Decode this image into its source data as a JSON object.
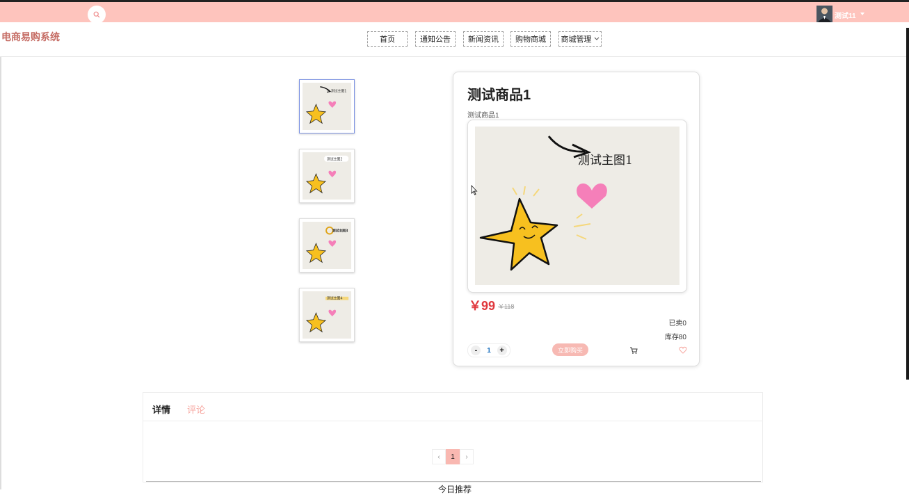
{
  "header": {
    "user_name": "测试11",
    "search_icon": "search-icon",
    "caret_icon": "caret-down-icon"
  },
  "logo": "电商易购系统",
  "nav": {
    "items": [
      {
        "label": "首页"
      },
      {
        "label": "通知公告"
      },
      {
        "label": "新闻资讯"
      },
      {
        "label": "购物商城"
      },
      {
        "label": "商城管理"
      }
    ]
  },
  "thumbnails": [
    {
      "caption": "测试主图1"
    },
    {
      "caption": "测试主图2"
    },
    {
      "caption": "测试主图3"
    },
    {
      "caption": "测试主图4"
    }
  ],
  "product": {
    "title": "测试商品1",
    "subtitle": "测试商品1",
    "main_image_caption": "测试主图1",
    "price": "￥99",
    "original_price": "￥118",
    "sold": "已卖0",
    "stock": "库存80",
    "quantity": "1",
    "minus": "-",
    "plus": "+",
    "buy_label": "立即购买"
  },
  "tabs": {
    "detail": "详情",
    "comment": "评论"
  },
  "pagination": {
    "prev": "‹",
    "current": "1",
    "next": "›"
  },
  "recommend_title": "今日推荐",
  "colors": {
    "topbar": "#fec4bd",
    "accent": "#f7a7a0",
    "price": "#e0393e",
    "logo": "#c56b63"
  }
}
